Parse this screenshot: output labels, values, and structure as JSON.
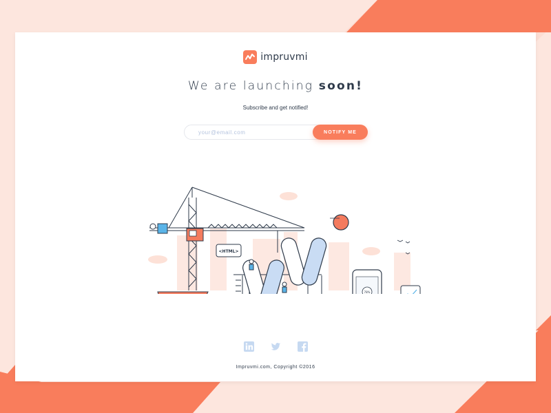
{
  "brand": {
    "name": "impruvmi",
    "accent_color": "#f97d5c",
    "logo_icon": "impruvmi-logo-icon"
  },
  "hero": {
    "headline_light": "We are launching",
    "headline_bold": "soon!",
    "subline": "Subscribe and get notified!"
  },
  "subscribe": {
    "email_placeholder": "your@email.com",
    "button_label": "NOTIFY ME"
  },
  "illustration": {
    "name": "construction-scene",
    "html_tag_label": "<HTML>",
    "phone_progress_label": "78%"
  },
  "social": {
    "icons": [
      "linkedin-icon",
      "twitter-icon",
      "facebook-icon"
    ]
  },
  "footer": {
    "copyright": "Impruvmi.com, Copyright ©2016"
  }
}
